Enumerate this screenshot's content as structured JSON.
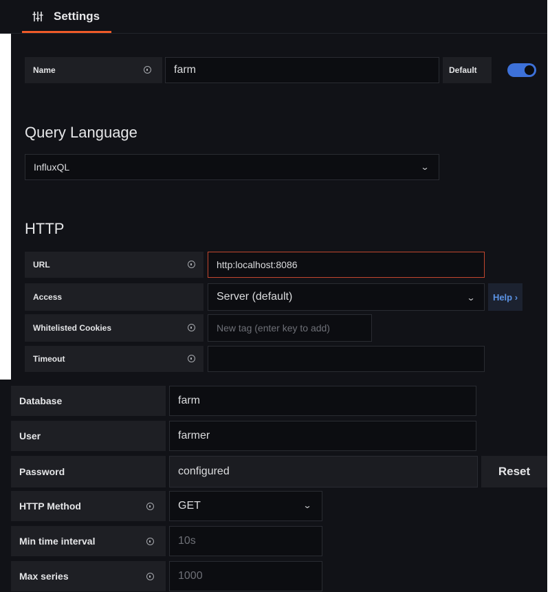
{
  "tab": {
    "label": "Settings",
    "icon": "sliders-icon"
  },
  "name_row": {
    "label": "Name",
    "value": "farm",
    "default_label": "Default",
    "default_on": true
  },
  "query_language": {
    "title": "Query Language",
    "selected": "InfluxQL"
  },
  "http": {
    "title": "HTTP",
    "url": {
      "label": "URL",
      "value": "http:localhost:8086"
    },
    "access": {
      "label": "Access",
      "selected": "Server (default)",
      "help_label": "Help ›"
    },
    "cookies": {
      "label": "Whitelisted Cookies",
      "placeholder": "New tag (enter key to add)"
    },
    "timeout": {
      "label": "Timeout",
      "value": ""
    }
  },
  "influx": {
    "database": {
      "label": "Database",
      "value": "farm"
    },
    "user": {
      "label": "User",
      "value": "farmer"
    },
    "password": {
      "label": "Password",
      "value": "configured",
      "reset_label": "Reset"
    },
    "method": {
      "label": "HTTP Method",
      "selected": "GET"
    },
    "min_interval": {
      "label": "Min time interval",
      "placeholder": "10s"
    },
    "max_series": {
      "label": "Max series",
      "placeholder": "1000"
    }
  },
  "colors": {
    "accent": "#3d71d9",
    "tab_underline": "#f05a28",
    "error_border": "#c4472e",
    "background": "#111217"
  }
}
